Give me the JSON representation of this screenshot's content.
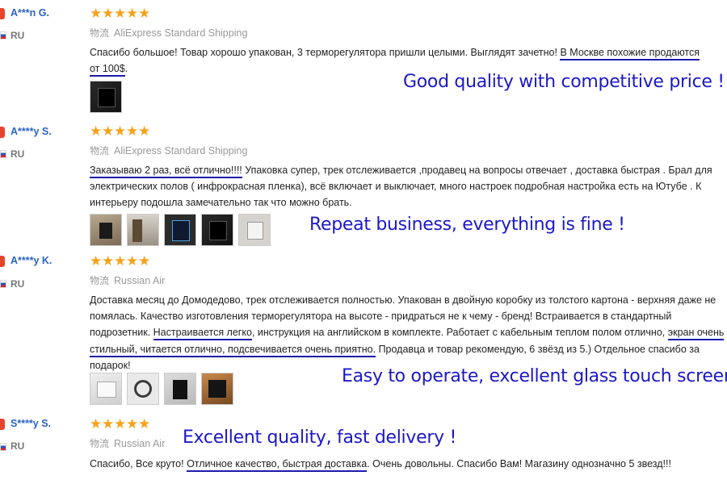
{
  "reviews": [
    {
      "user": "A***n G.",
      "country": "RU",
      "stars": 5,
      "shipping_prefix": "物流",
      "shipping": "AliExpress Standard Shipping",
      "text_parts": [
        "Спасибо большое! Товар хорошо упакован, 3 терморегулятора пришли целыми. Выглядят зачетно! ",
        "В Москве похожие продаются от 100$",
        "."
      ],
      "callout": "Good quality with competitive price !",
      "thumbnails": [
        "dark-thermostat-photo"
      ]
    },
    {
      "user": "A****y S.",
      "country": "RU",
      "stars": 5,
      "shipping_prefix": "物流",
      "shipping": "AliExpress Standard Shipping",
      "text_parts": [
        "Заказываю 2 раз, всё отлично!!!!",
        " Упаковка супер, трек отслеживается ,продавец на вопросы отвечает , доставка быстрая . Брал для электрических полов ( инфрокрасная пленка), всё включает и выключает, много настроек подробная настройка есть на Ютубе . К интерьеру подошла замечательно так что можно брать."
      ],
      "callout": "Repeat business, everything is fine !",
      "thumbnails": [
        "wall-photo",
        "room-photo",
        "blue-screen-photo",
        "lit-screen-photo",
        "grey-wall-photo"
      ]
    },
    {
      "user": "A****y K.",
      "country": "RU",
      "stars": 5,
      "shipping_prefix": "物流",
      "shipping": "Russian Air",
      "text_parts": [
        "Доставка месяц до Домодедово, трек отслеживается полностью. Упакован в двойную коробку из толстого картона - верхняя даже не помялась. Качество изготовления терморегулятора на высоте - придраться не к чему - бренд! Встраивается в стандартный подрозетник. ",
        "Настраивается легко",
        ", инструкция на английском в комплекте. Работает с кабельным теплом полом отлично, ",
        "экран очень стильный, читается отлично, подсвечивается очень приятно.",
        " Продавца и товар рекомендую, 6 звёзд из 5.) Отдельное спасибо за подарок!"
      ],
      "callout": "Easy to operate, excellent glass touch screen !",
      "thumbnails": [
        "box-photo",
        "cable-photo",
        "black-panel-photo",
        "warm-light-photo"
      ]
    },
    {
      "user": "S****y S.",
      "country": "RU",
      "stars": 5,
      "shipping_prefix": "物流",
      "shipping": "Russian Air",
      "text_parts": [
        "Спасибо, Все круто! ",
        "Отличное качество, быстрая доставка",
        ". Очень довольны. Спасибо Вам! Магазину однозначно 5 звезд!!!"
      ],
      "callout": "Excellent quality, fast delivery !",
      "thumbnails": []
    }
  ],
  "colors": {
    "username": "#2b62c4",
    "stars": "#f7a21b",
    "callout": "#1c18c8",
    "underline": "#1b1bab"
  }
}
